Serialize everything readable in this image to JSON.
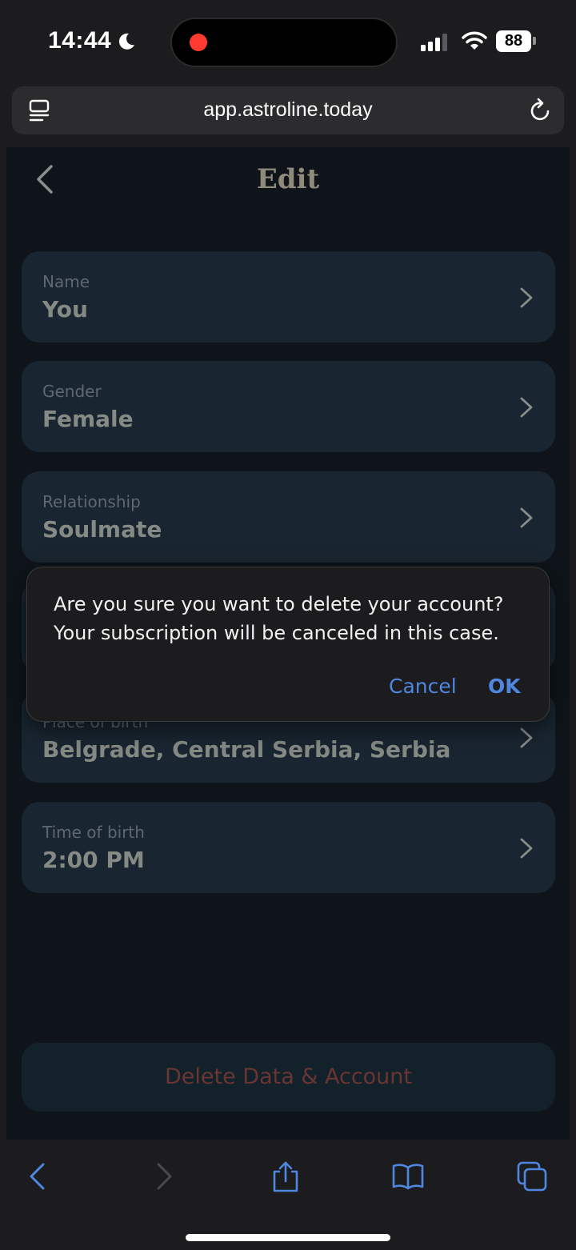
{
  "status_bar": {
    "time": "14:44",
    "battery": "88"
  },
  "browser": {
    "url": "app.astroline.today"
  },
  "header": {
    "title": "Edit"
  },
  "fields": [
    {
      "label": "Name",
      "value": "You"
    },
    {
      "label": "Gender",
      "value": "Female"
    },
    {
      "label": "Relationship",
      "value": "Soulmate"
    },
    {
      "label": "Place of birth",
      "value": "Belgrade, Central Serbia, Serbia"
    },
    {
      "label": "Time of birth",
      "value": "2:00 PM"
    }
  ],
  "delete_button": {
    "label": "Delete Data & Account"
  },
  "dialog": {
    "message": "Are you sure you want to delete your account? Your subscription will be canceled in this case.",
    "cancel_label": "Cancel",
    "ok_label": "OK"
  },
  "colors": {
    "accent": "#4f86e0",
    "delete_text": "#6a3532",
    "card_bg": "#192530",
    "page_bg": "#0e1419"
  }
}
